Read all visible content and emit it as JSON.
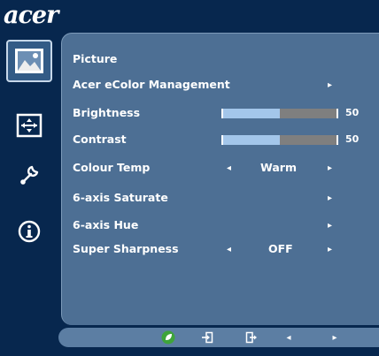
{
  "brand": {
    "logo_text": "acer"
  },
  "sidebar": {
    "tabs": [
      {
        "name": "picture",
        "icon": "picture-icon",
        "active": true
      },
      {
        "name": "display",
        "icon": "display-position-icon",
        "active": false
      },
      {
        "name": "settings",
        "icon": "wrench-icon",
        "active": false
      },
      {
        "name": "information",
        "icon": "info-icon",
        "active": false
      }
    ]
  },
  "menu": {
    "title": "Picture",
    "items": [
      {
        "label": "Acer eColor Management",
        "submenu": true
      },
      {
        "label": "Brightness",
        "value": "50",
        "level": 0.5
      },
      {
        "label": "Contrast",
        "value": "50",
        "level": 0.5
      },
      {
        "label": "Colour Temp",
        "option": "Warm"
      },
      {
        "label": "6-axis Saturate",
        "submenu": true
      },
      {
        "label": "6-axis Hue",
        "submenu": true
      },
      {
        "label": "Super Sharpness",
        "option": "OFF"
      }
    ]
  },
  "glyphs": {
    "right": "▸",
    "left": "◂"
  },
  "colors": {
    "background": "#07274e",
    "panel": "#4d6f94",
    "bar_fill": "#a3c6ea",
    "bar_track": "#7f7f7f",
    "power_button": "#3ea43a"
  },
  "bottom_bar": {
    "buttons": [
      {
        "name": "auto-power-button",
        "icon": "power-leaf-icon"
      },
      {
        "name": "enter-button",
        "icon": "enter-icon"
      },
      {
        "name": "exit-button",
        "icon": "exit-icon"
      },
      {
        "name": "left-button",
        "icon": "arrow-left-icon"
      },
      {
        "name": "right-button",
        "icon": "arrow-right-icon"
      }
    ]
  }
}
